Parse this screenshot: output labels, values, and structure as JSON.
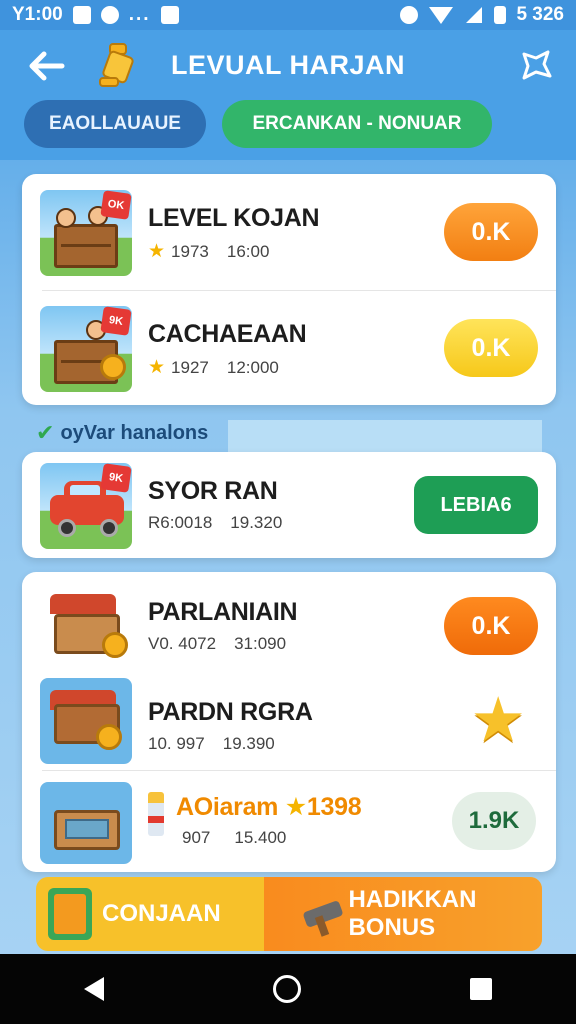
{
  "status_bar": {
    "time": "Y1:00",
    "battery_text": "5 326",
    "dots": "..."
  },
  "header": {
    "title": "LEVUAL HARJAN"
  },
  "tabs": [
    {
      "label": "EAOLLAUAUE"
    },
    {
      "label": "ERCANKAN - NONUAR"
    }
  ],
  "card1": {
    "items": [
      {
        "title": "LEVEL KOJAN",
        "meta1": "1973",
        "meta2": "16:00",
        "badge": "OK",
        "action": "0.K"
      },
      {
        "title": "CACHAEAAN",
        "meta1": "1927",
        "meta2": "12:000",
        "badge": "9K",
        "action": "0.K"
      }
    ]
  },
  "section": {
    "label": "oyVar hanalons"
  },
  "card2": {
    "title": "SYOR RAN",
    "meta": "R6:0018",
    "meta2": "19.320",
    "badge": "9K",
    "action": "LEBIA6"
  },
  "card3": {
    "items": [
      {
        "title": "PARLANIAIN",
        "meta": "V0. 4072",
        "meta2": "31:090",
        "action": "0.K"
      },
      {
        "title": "PARDN RGRA",
        "meta": "10. 997",
        "meta2": "19.390"
      },
      {
        "title": "AOiaram",
        "title_star": "★",
        "title_num": "1398",
        "meta": "907",
        "meta2": "15.400",
        "action": "1.9K"
      }
    ]
  },
  "banner": {
    "left_label": "CONJAAN",
    "right_label": "HADIKKAN BONUS"
  },
  "colors": {
    "header_blue": "#4aa0e6",
    "orange": "#f27f12",
    "yellow": "#f6c81a",
    "green": "#1e9e55"
  }
}
